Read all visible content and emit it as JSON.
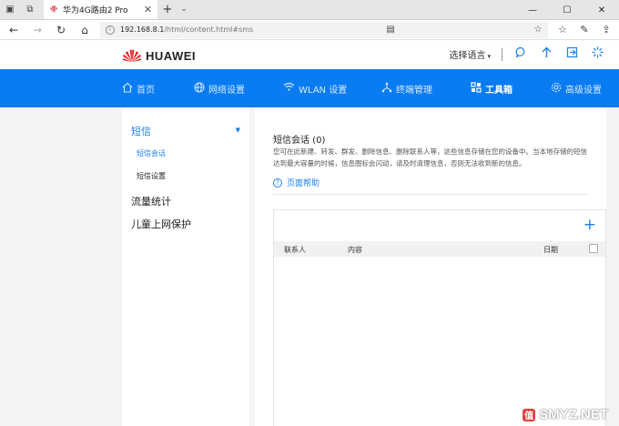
{
  "browser": {
    "tab_title": "华为4G路由2 Pro",
    "url_host": "192.168.8.1",
    "url_path": "/html/content.html#sms",
    "icons": [
      "tab-manager-icon",
      "back-icon",
      "forward-icon",
      "refresh-icon",
      "home-icon",
      "reading-view-icon",
      "favorite-star-icon",
      "favorites-bar-icon",
      "pen-icon",
      "share-icon"
    ]
  },
  "header": {
    "brand": "HUAWEI",
    "language": "选择语言",
    "brand_color": "#e3272b"
  },
  "nav": {
    "home": "首页",
    "network": "网络设置",
    "wlan": "WLAN 设置",
    "terminal": "终端管理",
    "toolbox": "工具箱",
    "advanced": "高级设置",
    "bg_color": "#0a7cf2"
  },
  "sidebar": {
    "sms": "短信",
    "sms_chat": "短信会话",
    "sms_settings": "短信设置",
    "traffic": "流量统计",
    "child": "儿童上网保护"
  },
  "content": {
    "title": "短信会话 (0)",
    "description": "您可在此新建、转发、群发、删除信息、删除联系人等，这些信息存储在您的设备中。当本地存储的短信达到最大容量的时候，信息图标会闪动，请及时清理信息，否则无法收到新的信息。",
    "help": "页面帮助",
    "columns": {
      "contact": "联系人",
      "content": "内容",
      "date": "日期"
    }
  },
  "watermark": {
    "text": "SMYZ.NET",
    "badge": "值"
  }
}
